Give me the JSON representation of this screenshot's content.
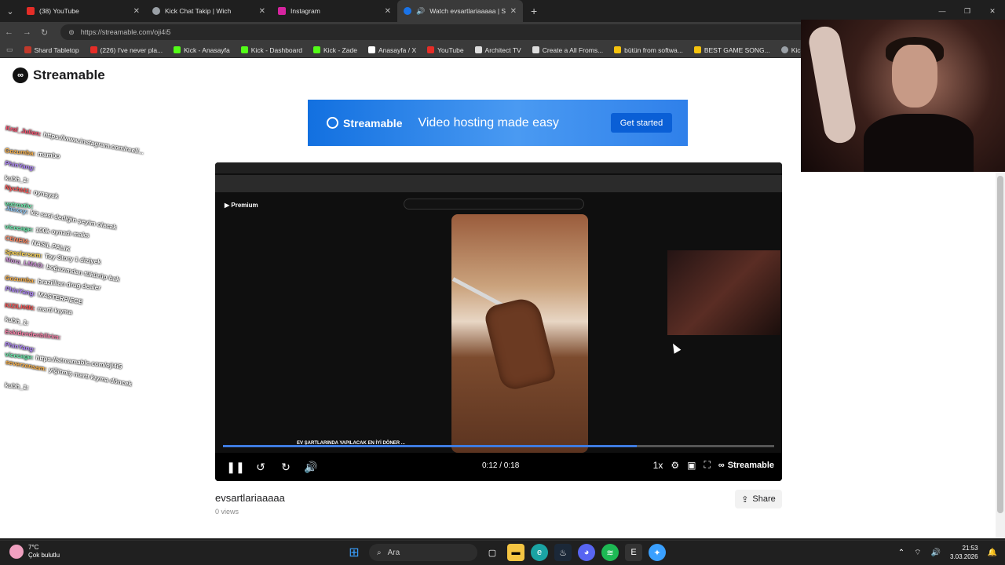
{
  "browser": {
    "tabs": [
      {
        "title": "(38) YouTube",
        "color": "#e52d27",
        "active": false
      },
      {
        "title": "Kick Chat Takip | Wich",
        "color": "#9aa0a6",
        "active": false
      },
      {
        "title": "Instagram",
        "color": "#d6249f",
        "active": false
      },
      {
        "title": "Watch evsartlariaaaaa | Stream",
        "color": "#1a73e8",
        "active": true
      }
    ],
    "url": "https://streamable.com/oji4i5",
    "bookmarks": [
      {
        "label": "Shard Tabletop",
        "color": "#c0392b"
      },
      {
        "label": "(226) I've never pla...",
        "color": "#e52d27"
      },
      {
        "label": "Kick - Anasayfa",
        "color": "#53fc18"
      },
      {
        "label": "Kick - Dashboard",
        "color": "#53fc18"
      },
      {
        "label": "Kick - Zade",
        "color": "#53fc18"
      },
      {
        "label": "Anasayfa / X",
        "color": "#ffffff"
      },
      {
        "label": "YouTube",
        "color": "#e52d27"
      },
      {
        "label": "Architect TV",
        "color": "#dddddd"
      },
      {
        "label": "Create a All Froms...",
        "color": "#dddddd"
      },
      {
        "label": "bütün from softwa...",
        "color": "#f4c20d"
      },
      {
        "label": "BEST GAME SONG...",
        "color": "#f4c20d"
      },
      {
        "label": "Kick Ch",
        "color": "#9aa0a6"
      }
    ]
  },
  "page": {
    "brand": "Streamable",
    "ad": {
      "brand": "Streamable",
      "tagline": "Video hosting made easy",
      "cta": "Get started"
    },
    "video": {
      "title": "evsartlariaaaaa",
      "views": "0 views",
      "time": "0:12 / 0:18",
      "progress": 0.75,
      "speed": "1x",
      "player_brand": "Streamable",
      "inner_caption": "EV ŞARTLARINDA YAPILACAK EN İYİ DÖNER ..."
    },
    "share_label": "Share"
  },
  "chat_overlay": [
    {
      "user": "Kral_Julien:",
      "msg": "https://www.instagram.com/reel/...",
      "color": "#ff4d6d"
    },
    {
      "user": "Gozumba:",
      "msg": "mambo",
      "color": "#ffb347"
    },
    {
      "user": "PhinYang:",
      "msg": "",
      "color": "#b388ff"
    },
    {
      "user": "kubh_1:",
      "msg": "",
      "color": "#ffffff"
    },
    {
      "user": "Nycht41:",
      "msg": "oynayak",
      "color": "#ff5252"
    },
    {
      "user": "votroxtiv:",
      "msg": "",
      "color": "#69f0ae"
    },
    {
      "user": "Jasxxy:",
      "msg": "kiz sesi dediğin şeyim olacak",
      "color": "#90caf9"
    },
    {
      "user": "vicecage:",
      "msg": "100k oynadı maks",
      "color": "#69f0ae"
    },
    {
      "user": "CENEM:",
      "msg": "NASIL PALIK",
      "color": "#ff8a65"
    },
    {
      "user": "Speelersom:",
      "msg": "Toy Story 1 diziyek",
      "color": "#ffd54f"
    },
    {
      "user": "Mora_LMAO:",
      "msg": "boğazımdan tükürüp bak",
      "color": "#ce93d8"
    },
    {
      "user": "Gozumba:",
      "msg": "brazillian drug dealer",
      "color": "#ffb347"
    },
    {
      "user": "PhinYang:",
      "msg": "MASTERPIECE",
      "color": "#b388ff"
    },
    {
      "user": "KIZILH4N:",
      "msg": "marti kıyma",
      "color": "#ff5252"
    },
    {
      "user": "kubh_1:",
      "msg": "",
      "color": "#ffffff"
    },
    {
      "user": "Eskidendenbilirim:",
      "msg": "",
      "color": "#ff80ab"
    },
    {
      "user": "PhinYang:",
      "msg": "",
      "color": "#b388ff"
    },
    {
      "user": "vicecage:",
      "msg": "https://streamable.com/oji4i5",
      "color": "#69f0ae"
    },
    {
      "user": "severzensam:",
      "msg": "yiğitmiş martı kıyma döncek",
      "color": "#ffb347"
    },
    {
      "user": "kubh_1:",
      "msg": "",
      "color": "#ffffff"
    }
  ],
  "taskbar": {
    "temp": "7°C",
    "weather": "Çok bulutlu",
    "search_placeholder": "Ara",
    "time": "21:53",
    "date": "3.03.2026"
  }
}
